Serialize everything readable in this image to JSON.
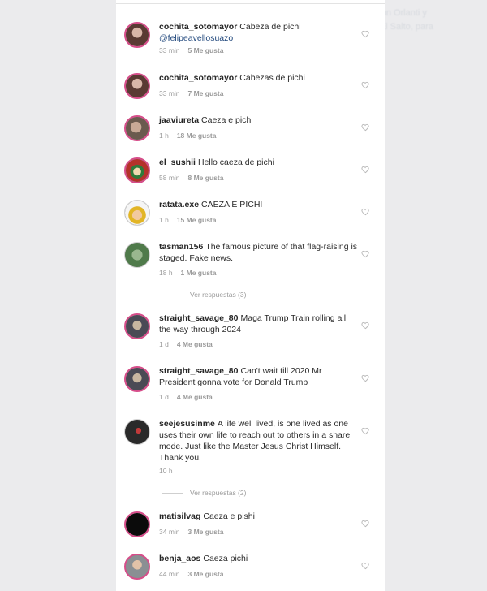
{
  "background_text": [
    "o con Orlanti y",
    "or El Salto, para"
  ],
  "comments": [
    {
      "user": "cochita_sotomayor",
      "text": "Cabeza de pichi",
      "mention": "@felipeavellosuazo",
      "time": "33 min",
      "likes": "5 Me gusta",
      "avatar_color": "#5a3a33"
    },
    {
      "user": "cochita_sotomayor",
      "text": "Cabezas de pichi",
      "time": "33 min",
      "likes": "7 Me gusta",
      "avatar_color": "#5a3a33"
    },
    {
      "user": "jaaviureta",
      "text": "Caeza e pichi",
      "time": "1 h",
      "likes": "18 Me gusta",
      "avatar_color": "#6b5a4e"
    },
    {
      "user": "el_sushii",
      "text": "Hello caeza de pichi",
      "time": "58 min",
      "likes": "8 Me gusta",
      "avatar_color": "#b5322a"
    },
    {
      "user": "ratata.exe",
      "text": "CAEZA E PICHI",
      "time": "1 h",
      "likes": "15 Me gusta",
      "avatar_color": "#e2b526"
    },
    {
      "user": "tasman156",
      "text": "The famous picture of that flag-raising is staged. Fake news.",
      "time": "18 h",
      "likes": "1 Me gusta",
      "avatar_color": "#4f7a4a"
    },
    {
      "user": "straight_savage_80",
      "text": "Maga Trump Train rolling all the way through 2024",
      "time": "1 d",
      "likes": "4 Me gusta",
      "avatar_color": "#4a4a55"
    },
    {
      "user": "straight_savage_80",
      "text": "Can't wait till 2020 Mr President gonna vote for Donald Trump",
      "time": "1 d",
      "likes": "4 Me gusta",
      "avatar_color": "#4a4a55"
    },
    {
      "user": "seejesusinme",
      "text": "A life well lived, is one lived as one uses their own life to reach out to others in a share mode. Just like the Master Jesus Christ Himself. Thank you.",
      "time": "10 h",
      "likes": "",
      "avatar_color": "#2a2a2a"
    },
    {
      "user": "matisilvag",
      "text": "Caeza e pishi",
      "time": "34 min",
      "likes": "3 Me gusta",
      "avatar_color": "#0b0b0b"
    },
    {
      "user": "benja_aos",
      "text": "Caeza pichi",
      "time": "44 min",
      "likes": "3 Me gusta",
      "avatar_color": "#8a8f93"
    }
  ],
  "replies": [
    "Ver respuestas (3)",
    "Ver respuestas (2)"
  ],
  "colors": {
    "story_ring": "#d64e8a",
    "mention": "#20477c",
    "meta": "#9a9a9a"
  }
}
